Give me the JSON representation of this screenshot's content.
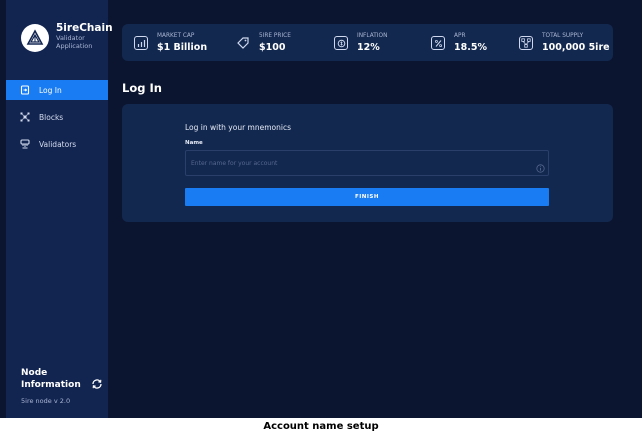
{
  "app": {
    "name": "5ireChain",
    "subtitle_line1": "Validator",
    "subtitle_line2": "Application"
  },
  "sidebar": {
    "items": [
      {
        "label": "Log In",
        "icon": "login-icon",
        "active": true
      },
      {
        "label": "Blocks",
        "icon": "blocks-icon",
        "active": false
      },
      {
        "label": "Validators",
        "icon": "validators-icon",
        "active": false
      }
    ],
    "node": {
      "title_line1": "Node",
      "title_line2": "Information",
      "version": "5ire node v 2.0",
      "refresh_icon": "refresh-icon"
    }
  },
  "stats": [
    {
      "label": "MARKET CAP",
      "value": "$1 Billion",
      "icon": "bar-chart-icon"
    },
    {
      "label": "5IRE PRICE",
      "value": "$100",
      "icon": "price-tag-icon"
    },
    {
      "label": "INFLATION",
      "value": "12%",
      "icon": "coin-icon"
    },
    {
      "label": "APR",
      "value": "18.5%",
      "icon": "percent-icon"
    },
    {
      "label": "TOTAL SUPPLY",
      "value": "100,000 5ire",
      "icon": "network-icon"
    }
  ],
  "main": {
    "title": "Log In",
    "card": {
      "heading": "Log in with your mnemonics",
      "field_label": "Name",
      "placeholder": "Enter name for your account",
      "value": "",
      "info_icon": "info-icon",
      "button_label": "FINISH"
    }
  },
  "caption": "Account name setup",
  "colors": {
    "background": "#0b1530",
    "sidebar": "#122551",
    "panel": "#13284f",
    "accent": "#1a7cf2"
  }
}
